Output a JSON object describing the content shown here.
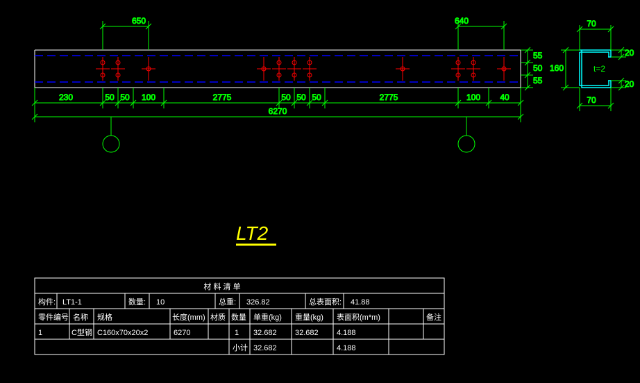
{
  "dims": {
    "top_left": "650",
    "top_right": "640",
    "side_v1": "55",
    "side_v2": "50",
    "side_v3": "55",
    "bot_a": "230",
    "bot_b": "50",
    "bot_c": "50",
    "bot_d": "100",
    "bot_e": "2775",
    "bot_f": "50",
    "bot_g": "50",
    "bot_h": "50",
    "bot_i": "2775",
    "bot_j": "100",
    "bot_k": "40",
    "overall": "6270",
    "sec_top": "70",
    "sec_h": "160",
    "sec_bot": "70",
    "sec_r1": "20",
    "sec_r2": "20",
    "sec_t": "t=2"
  },
  "title": "LT2",
  "table": {
    "header": "材 料 清 单",
    "r1_label": "构件:",
    "r1_name": "LT1-1",
    "r1_qty_label": "数量:",
    "r1_qty": "10",
    "r1_wt_label": "总重:",
    "r1_wt": "326.82",
    "r1_area_label": "总表面积:",
    "r1_area": "41.88",
    "h_partno": "零件编号",
    "h_name": "名称",
    "h_spec": "规格",
    "h_len": "长度(mm)",
    "h_mat": "材质",
    "h_qty": "数量",
    "h_uw": "单重(kg)",
    "h_tw": "重量(kg)",
    "h_sa": "表面积(m*m)",
    "h_note": "备注",
    "d_partno": "1",
    "d_name": "C型钢",
    "d_spec": "C160x70x20x2",
    "d_len": "6270",
    "d_qty": "1",
    "d_uw": "32.682",
    "d_tw": "32.682",
    "d_sa": "4.188",
    "f_label": "小计",
    "f_tw": "32.682",
    "f_sa": "4.188"
  }
}
